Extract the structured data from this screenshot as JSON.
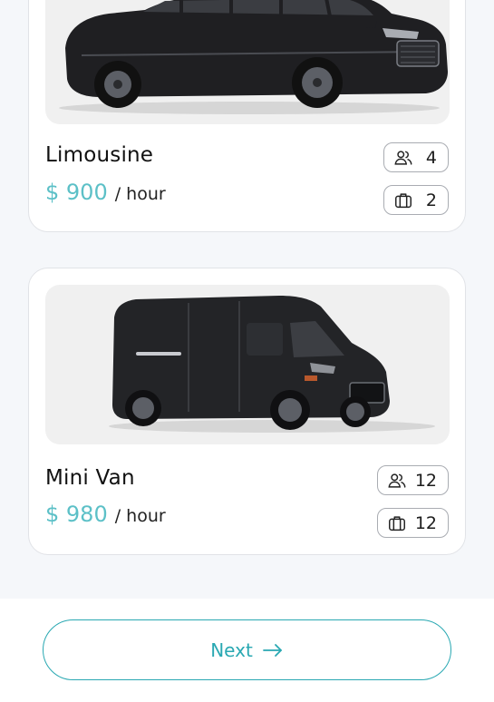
{
  "vehicles": [
    {
      "name": "Limousine",
      "price": "$ 900",
      "unit": "/ hour",
      "passengers": "4",
      "luggage": "2",
      "image_icon": "limousine-car-icon"
    },
    {
      "name": "Mini Van",
      "price": "$ 980",
      "unit": "/ hour",
      "passengers": "12",
      "luggage": "12",
      "image_icon": "van-icon"
    }
  ],
  "footer": {
    "next_label": "Next",
    "next_icon": "arrow-right-icon"
  },
  "colors": {
    "accent": "#29a8b2",
    "price": "#5cc0c7",
    "background": "#f5f7fa",
    "card": "#ffffff",
    "vehicle_body": "#1f1f22"
  }
}
